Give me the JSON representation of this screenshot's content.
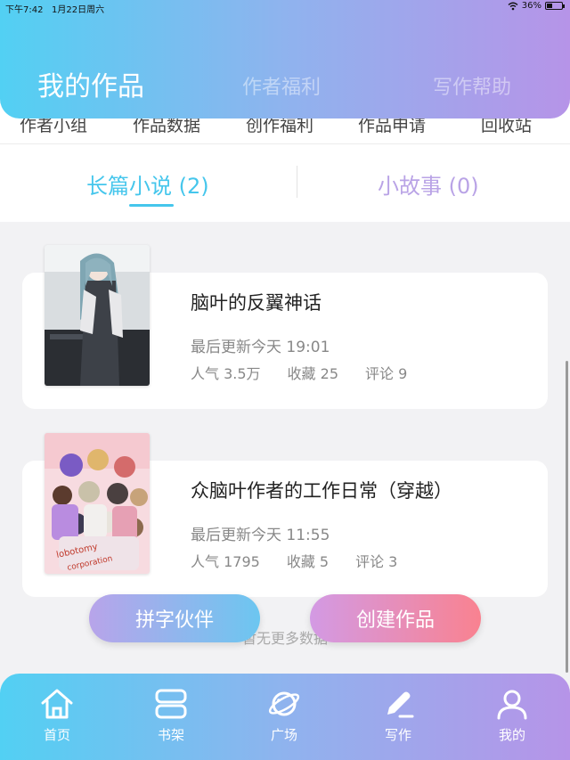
{
  "status_bar": {
    "time": "下午7:42",
    "date": "1月22日周六",
    "battery": "36%"
  },
  "header": {
    "tabs": [
      "我的作品",
      "作者福利",
      "写作帮助"
    ],
    "active_tab": "我的作品"
  },
  "submenu": [
    "作者小组",
    "作品数据",
    "创作福利",
    "作品申请",
    "回收站"
  ],
  "novel_tabs": {
    "long": "长篇小说 (2)",
    "short": "小故事 (0)"
  },
  "works": [
    {
      "title": "脑叶的反翼神话",
      "updated": "最后更新今天 19:01",
      "popularity": "人气 3.5万",
      "favorites": "收藏 25",
      "comments": "评论 9"
    },
    {
      "title": "众脑叶作者的工作日常（穿越）",
      "updated": "最后更新今天 11:55",
      "popularity": "人气 1795",
      "favorites": "收藏 5",
      "comments": "评论 3"
    }
  ],
  "footer": {
    "no_more": "暂无更多数据",
    "partner_button": "拼字伙伴",
    "create_button": "创建作品"
  },
  "tabbar": [
    "首页",
    "书架",
    "广场",
    "写作",
    "我的"
  ],
  "colors": {
    "accent_blue": "#45c6ec",
    "accent_purple": "#b694e8",
    "accent_pink": "#f98290"
  }
}
